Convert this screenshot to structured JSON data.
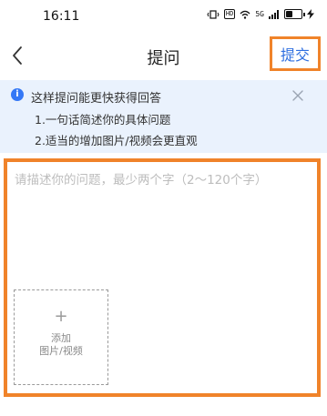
{
  "status_bar": {
    "time": "16:11",
    "icons": [
      "vibrate-icon",
      "hd-icon",
      "wifi-icon",
      "signal-icon",
      "battery-icon",
      "charging-icon"
    ],
    "hd_label": "HD",
    "network_label": "5G"
  },
  "nav": {
    "title": "提问",
    "submit_label": "提交"
  },
  "tip": {
    "title": "这样提问能更快获得回答",
    "line1": "1.一句话简述你的具体问题",
    "line2": "2.适当的增加图片/视频会更直观",
    "info_glyph": "i"
  },
  "editor": {
    "placeholder": "请描述你的问题，最少两个字（2～120个字）",
    "value": ""
  },
  "add_media": {
    "plus": "+",
    "line1": "添加",
    "line2": "图片/视频"
  },
  "colors": {
    "accent": "#2f6fe0",
    "highlight_border": "#f0832a",
    "banner_bg": "#eaf2fd",
    "info_icon": "#3478f6"
  }
}
